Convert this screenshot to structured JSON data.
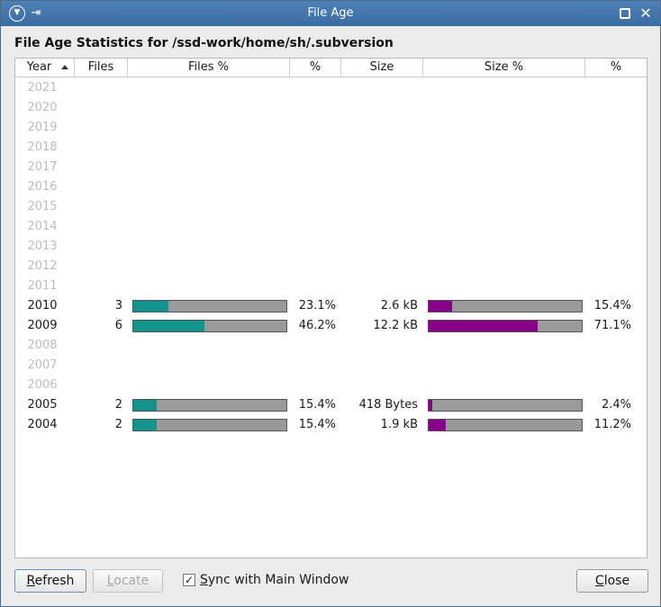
{
  "window": {
    "title": "File Age"
  },
  "heading": "File Age Statistics for /ssd-work/home/sh/.subversion",
  "table": {
    "columns": [
      "Year",
      "Files",
      "Files %",
      "%",
      "Size",
      "Size %",
      "%"
    ],
    "sorted_by": "Year",
    "rows": [
      {
        "year": "2021",
        "files": "",
        "files_pct": "",
        "size": "",
        "size_pct": "",
        "files_frac": 0,
        "size_frac": 0
      },
      {
        "year": "2020",
        "files": "",
        "files_pct": "",
        "size": "",
        "size_pct": "",
        "files_frac": 0,
        "size_frac": 0
      },
      {
        "year": "2019",
        "files": "",
        "files_pct": "",
        "size": "",
        "size_pct": "",
        "files_frac": 0,
        "size_frac": 0
      },
      {
        "year": "2018",
        "files": "",
        "files_pct": "",
        "size": "",
        "size_pct": "",
        "files_frac": 0,
        "size_frac": 0
      },
      {
        "year": "2017",
        "files": "",
        "files_pct": "",
        "size": "",
        "size_pct": "",
        "files_frac": 0,
        "size_frac": 0
      },
      {
        "year": "2016",
        "files": "",
        "files_pct": "",
        "size": "",
        "size_pct": "",
        "files_frac": 0,
        "size_frac": 0
      },
      {
        "year": "2015",
        "files": "",
        "files_pct": "",
        "size": "",
        "size_pct": "",
        "files_frac": 0,
        "size_frac": 0
      },
      {
        "year": "2014",
        "files": "",
        "files_pct": "",
        "size": "",
        "size_pct": "",
        "files_frac": 0,
        "size_frac": 0
      },
      {
        "year": "2013",
        "files": "",
        "files_pct": "",
        "size": "",
        "size_pct": "",
        "files_frac": 0,
        "size_frac": 0
      },
      {
        "year": "2012",
        "files": "",
        "files_pct": "",
        "size": "",
        "size_pct": "",
        "files_frac": 0,
        "size_frac": 0
      },
      {
        "year": "2011",
        "files": "",
        "files_pct": "",
        "size": "",
        "size_pct": "",
        "files_frac": 0,
        "size_frac": 0
      },
      {
        "year": "2010",
        "files": "3",
        "files_pct": "23.1%",
        "size": "2.6 kB",
        "size_pct": "15.4%",
        "files_frac": 0.231,
        "size_frac": 0.154
      },
      {
        "year": "2009",
        "files": "6",
        "files_pct": "46.2%",
        "size": "12.2 kB",
        "size_pct": "71.1%",
        "files_frac": 0.462,
        "size_frac": 0.711
      },
      {
        "year": "2008",
        "files": "",
        "files_pct": "",
        "size": "",
        "size_pct": "",
        "files_frac": 0,
        "size_frac": 0
      },
      {
        "year": "2007",
        "files": "",
        "files_pct": "",
        "size": "",
        "size_pct": "",
        "files_frac": 0,
        "size_frac": 0
      },
      {
        "year": "2006",
        "files": "",
        "files_pct": "",
        "size": "",
        "size_pct": "",
        "files_frac": 0,
        "size_frac": 0
      },
      {
        "year": "2005",
        "files": "2",
        "files_pct": "15.4%",
        "size": "418 Bytes",
        "size_pct": "2.4%",
        "files_frac": 0.154,
        "size_frac": 0.024
      },
      {
        "year": "2004",
        "files": "2",
        "files_pct": "15.4%",
        "size": "1.9 kB",
        "size_pct": "11.2%",
        "files_frac": 0.154,
        "size_frac": 0.112
      }
    ]
  },
  "buttons": {
    "refresh": {
      "mnemonic": "R",
      "rest": "efresh"
    },
    "locate": {
      "mnemonic": "L",
      "rest": "ocate"
    },
    "close": {
      "mnemonic": "C",
      "rest": "lose"
    }
  },
  "sync": {
    "pre": "",
    "mnemonic": "S",
    "rest": "ync with Main Window",
    "checked": true,
    "check_glyph": "✓"
  },
  "icons": {
    "menu": "triangle-down",
    "pin": "pin",
    "maximize": "square",
    "close": "x"
  },
  "colors": {
    "files_bar": "#12948c",
    "size_bar": "#880088",
    "bar_bg": "#9a9a9a",
    "titlebar": "#3e71a7"
  }
}
